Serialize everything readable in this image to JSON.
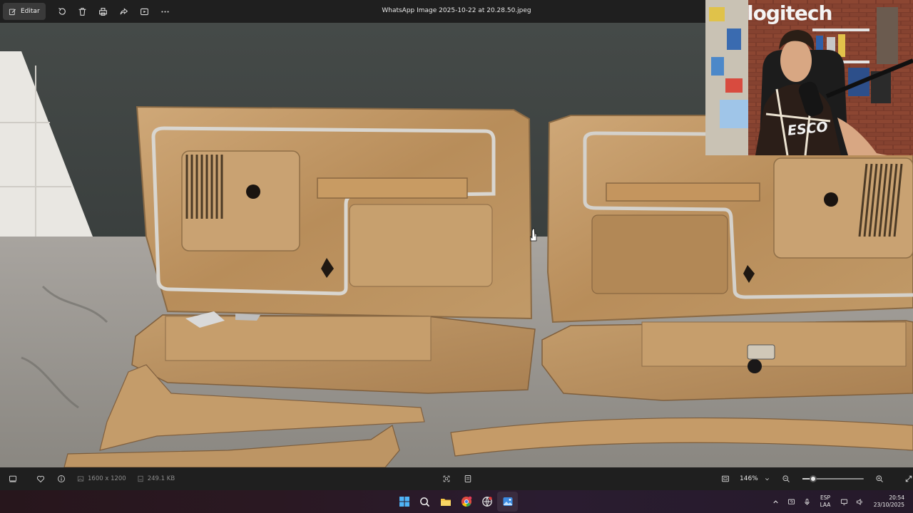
{
  "toolbar": {
    "edit_label": "Editar",
    "file_title": "WhatsApp Image 2025-10-22 at 20.28.50.jpeg"
  },
  "webcam": {
    "banner_text": "logitech",
    "shirt_text": "ESCO"
  },
  "status": {
    "dimensions": "1600 x 1200",
    "file_size": "249.1 KB",
    "zoom_label": "146%",
    "zoom_level_fraction": 0.18
  },
  "tray": {
    "lang_line1": "ESP",
    "lang_line2": "LAA",
    "time": "20:54",
    "date": "23/10/2025"
  },
  "icons": {
    "toolbar": [
      "edit-icon",
      "rotate-icon",
      "delete-icon",
      "print-icon",
      "share-icon",
      "slideshow-icon",
      "more-icon"
    ],
    "status": [
      "filmstrip-icon",
      "favorite-icon",
      "info-icon",
      "image-size-icon",
      "file-size-icon",
      "fit-icon",
      "compare-icon",
      "fit-window-icon",
      "chevron-down-icon",
      "zoom-out-icon",
      "zoom-in-icon",
      "fullscreen-icon"
    ],
    "taskbar": [
      "windows-start-icon",
      "search-icon",
      "file-explorer-icon",
      "chrome-icon",
      "browser-icon",
      "photos-icon"
    ],
    "tray": [
      "chevron-up-icon",
      "sync-icon",
      "microphone-icon",
      "screen-icon",
      "volume-icon"
    ]
  }
}
